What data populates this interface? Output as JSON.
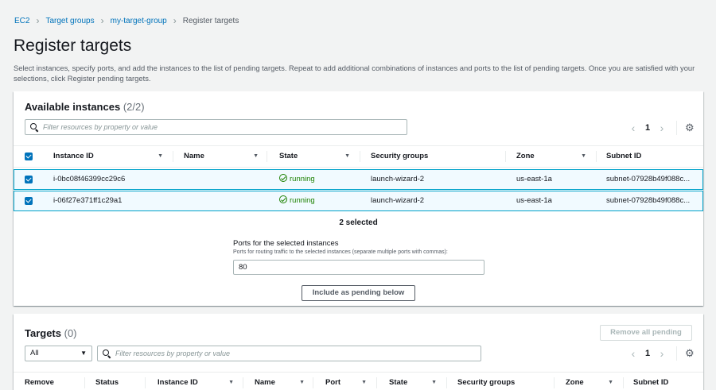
{
  "breadcrumb": {
    "items": [
      "EC2",
      "Target groups",
      "my-target-group"
    ],
    "current": "Register targets"
  },
  "page": {
    "title": "Register targets",
    "description": "Select instances, specify ports, and add the instances to the list of pending targets. Repeat to add additional combinations of instances and ports to the list of pending targets. Once you are satisfied with your selections, click Register pending targets."
  },
  "available": {
    "title": "Available instances",
    "count": "(2/2)",
    "search_placeholder": "Filter resources by property or value",
    "page_number": "1",
    "columns": [
      "Instance ID",
      "Name",
      "State",
      "Security groups",
      "Zone",
      "Subnet ID"
    ],
    "rows": [
      {
        "instance_id": "i-0bc08f46399cc29c6",
        "name": "",
        "state": "running",
        "security_group": "launch-wizard-2",
        "zone": "us-east-1a",
        "subnet": "subnet-07928b49f088c..."
      },
      {
        "instance_id": "i-06f27e371ff1c29a1",
        "name": "",
        "state": "running",
        "security_group": "launch-wizard-2",
        "zone": "us-east-1a",
        "subnet": "subnet-07928b49f088c..."
      }
    ],
    "selected_text": "2 selected",
    "ports_label": "Ports for the selected instances",
    "ports_hint": "Ports for routing traffic to the selected instances (separate multiple ports with commas):",
    "ports_value": "80",
    "include_button": "Include as pending below"
  },
  "targets": {
    "title": "Targets",
    "count": "(0)",
    "remove_all_button": "Remove all pending",
    "filter_select": "All",
    "search_placeholder": "Filter resources by property or value",
    "page_number": "1",
    "columns": [
      "Remove",
      "Status",
      "Instance ID",
      "Name",
      "Port",
      "State",
      "Security groups",
      "Zone",
      "Subnet ID"
    ]
  },
  "colors": {
    "link": "#0073bb",
    "running": "#1d8102",
    "selected_row_bg": "#f1faff",
    "selected_row_border": "#00a1c9"
  }
}
